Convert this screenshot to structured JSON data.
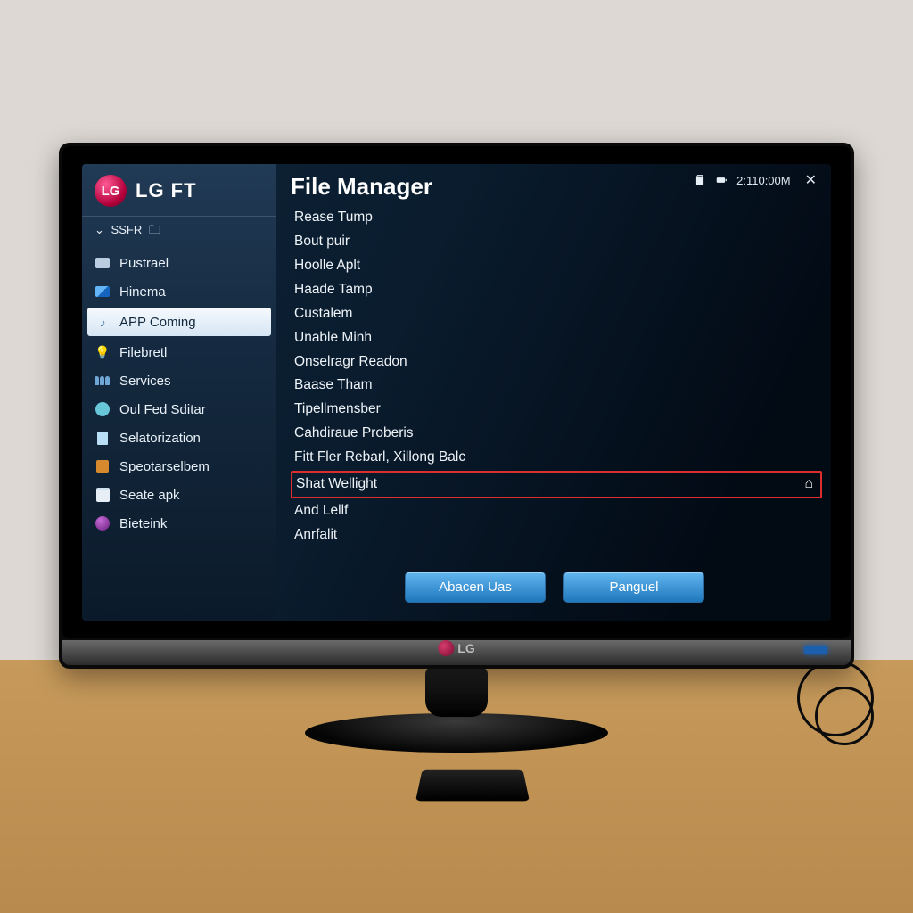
{
  "brand": {
    "logo_text": "LG",
    "title": "LG FT",
    "tv_label": "LG"
  },
  "status": {
    "time": "2:110:00M"
  },
  "sidebar": {
    "category": "SSFR",
    "items": [
      {
        "label": "Pustrael",
        "icon": "box"
      },
      {
        "label": "Hinema",
        "icon": "img"
      },
      {
        "label": "APP Coming",
        "icon": "music",
        "active": true
      },
      {
        "label": "Filebretl",
        "icon": "bulb"
      },
      {
        "label": "Services",
        "icon": "people"
      },
      {
        "label": "Oul Fed Sditar",
        "icon": "gear"
      },
      {
        "label": "Selatorization",
        "icon": "page"
      },
      {
        "label": "Speotarselbem",
        "icon": "sq"
      },
      {
        "label": "Seate apk",
        "icon": "bag"
      },
      {
        "label": "Bieteink",
        "icon": "ball"
      }
    ]
  },
  "main": {
    "title": "File Manager",
    "files": [
      {
        "label": "Rease Tump"
      },
      {
        "label": "Bout puir"
      },
      {
        "label": "Hoolle Aplt"
      },
      {
        "label": "Haade Tamp"
      },
      {
        "label": "Custalem"
      },
      {
        "label": "Unable Minh"
      },
      {
        "label": "Onselragr Readon"
      },
      {
        "label": "Baase Tham"
      },
      {
        "label": "Tipellmensber"
      },
      {
        "label": "Cahdiraue Proberis"
      },
      {
        "label": "Fitt Fler Rebarl, Xillong Balc"
      },
      {
        "label": "Shat Wellight",
        "highlighted": true
      },
      {
        "label": "And Lellf"
      },
      {
        "label": "Anrfalit"
      }
    ],
    "buttons": {
      "primary": "Abacen Uas",
      "secondary": "Panguel"
    }
  }
}
